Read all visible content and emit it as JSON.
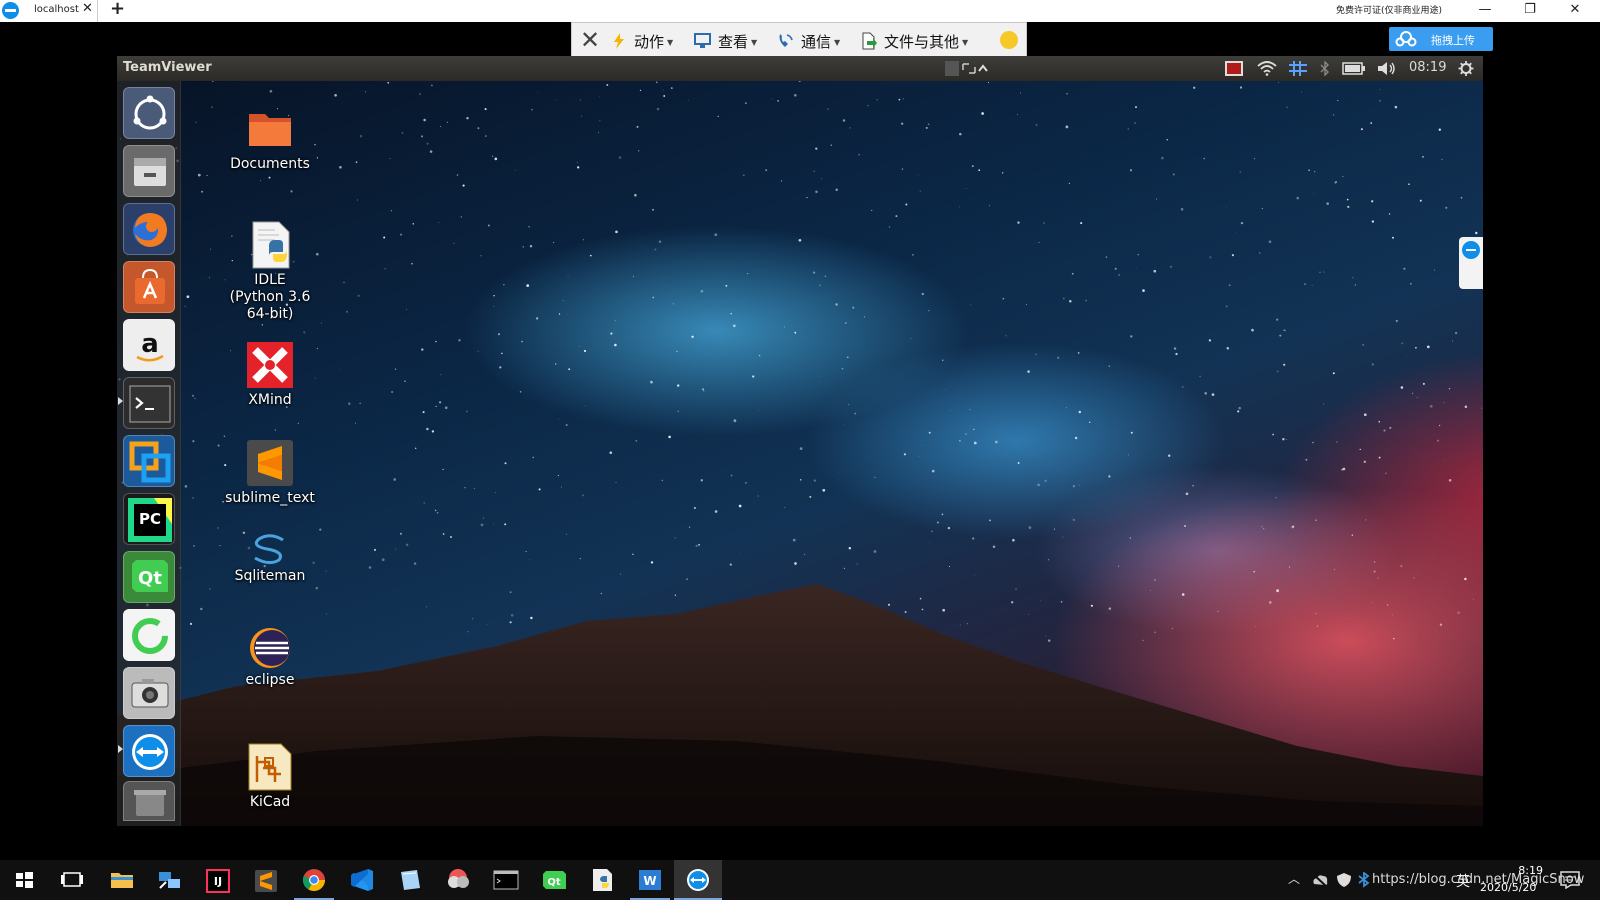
{
  "browser": {
    "tab_label": "localhost",
    "license_text": "免费许可证(仅非商业用途)"
  },
  "toolbar": {
    "items": [
      {
        "label": "动作"
      },
      {
        "label": "查看"
      },
      {
        "label": "通信"
      },
      {
        "label": "文件与其他"
      }
    ],
    "upload_label": "拖拽上传"
  },
  "ubuntu_panel": {
    "title": "TeamViewer",
    "clock": "08:19"
  },
  "desktop": {
    "icons": [
      {
        "label": "Documents"
      },
      {
        "label": "IDLE\n(Python 3.6\n64-bit)"
      },
      {
        "label": "XMind"
      },
      {
        "label": "sublime_text"
      },
      {
        "label": "Sqliteman"
      },
      {
        "label": "eclipse"
      },
      {
        "label": "KiCad"
      }
    ]
  },
  "launcher": {
    "apps": [
      "ubuntu-dash-icon",
      "files-icon",
      "firefox-icon",
      "software-center-icon",
      "amazon-icon",
      "terminal-icon",
      "virtualbox-icon",
      "pycharm-icon",
      "qt-creator-icon",
      "qt-designer-icon",
      "camera-icon",
      "teamviewer-icon",
      "trash-icon"
    ]
  },
  "taskbar": {
    "tray_text": "https://blog.csdn.net/MagicSnow",
    "ime_label": "英",
    "time": "8:19",
    "date": "2020/5/20"
  },
  "colors": {
    "teamviewer_blue": "#0e8ee9",
    "ubuntu_panel": "#3c3b37",
    "taskbar": "#101010"
  }
}
